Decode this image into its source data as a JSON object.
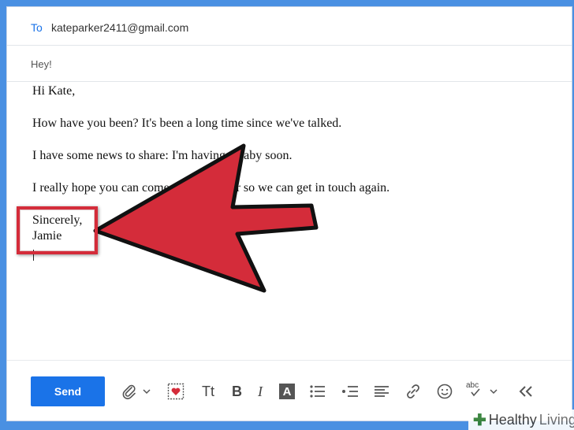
{
  "header": {
    "to_label": "To",
    "to_value": "kateparker2411@gmail.com",
    "subject_value": "Hey!"
  },
  "body": {
    "lines": [
      "Hi Kate,",
      "How have you been? It's been a long time since we've talked.",
      "I have some news to share: I'm having a baby soon.",
      "I really hope you can come to the shower so we can get in touch again.",
      "Sincerely,",
      "Jamie"
    ]
  },
  "toolbar": {
    "send_label": "Send",
    "icons": [
      "paperclip-icon",
      "chevron-down-icon",
      "stationery-icon",
      "text-size-icon",
      "bold-icon",
      "italic-icon",
      "font-color-icon",
      "bulleted-list-icon",
      "numbered-list-icon",
      "align-icon",
      "link-icon",
      "emoji-icon",
      "spellcheck-icon",
      "collapse-icon"
    ],
    "text_size_glyph": "Tt",
    "bold_glyph": "B",
    "italic_glyph": "I",
    "font_color_glyph": "A",
    "spellcheck_glyph": "abc"
  },
  "annotation": {
    "arrow_color": "#d42c3a"
  },
  "watermark": {
    "brand_first": "Healthy",
    "brand_second": "Living"
  },
  "colors": {
    "accent": "#1a73e8",
    "background": "#4a90e2"
  }
}
